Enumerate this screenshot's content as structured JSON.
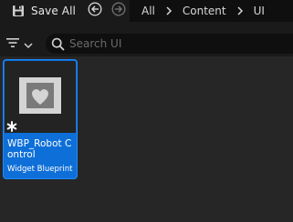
{
  "toolbar": {
    "save_all_label": "Save All",
    "save_icon": "save-all-icon",
    "back_icon": "arrow-back-icon",
    "forward_icon": "arrow-forward-icon"
  },
  "breadcrumb": {
    "items": [
      "All",
      "Content",
      "UI"
    ]
  },
  "filter": {
    "icon": "filter-icon",
    "dropdown_icon": "chevron-down-icon"
  },
  "search": {
    "placeholder": "Search UI",
    "value": ""
  },
  "assets": [
    {
      "name": "WBP_Robot Control",
      "type": "Widget Blueprint",
      "thumbnail_icon": "widget-blueprint-icon",
      "selected": true,
      "modified_marker": "asterisk-icon"
    }
  ],
  "colors": {
    "background": "#1a1a1a",
    "content_bg": "#262626",
    "selection": "#0e6fd8",
    "text": "#e8e8e8"
  }
}
